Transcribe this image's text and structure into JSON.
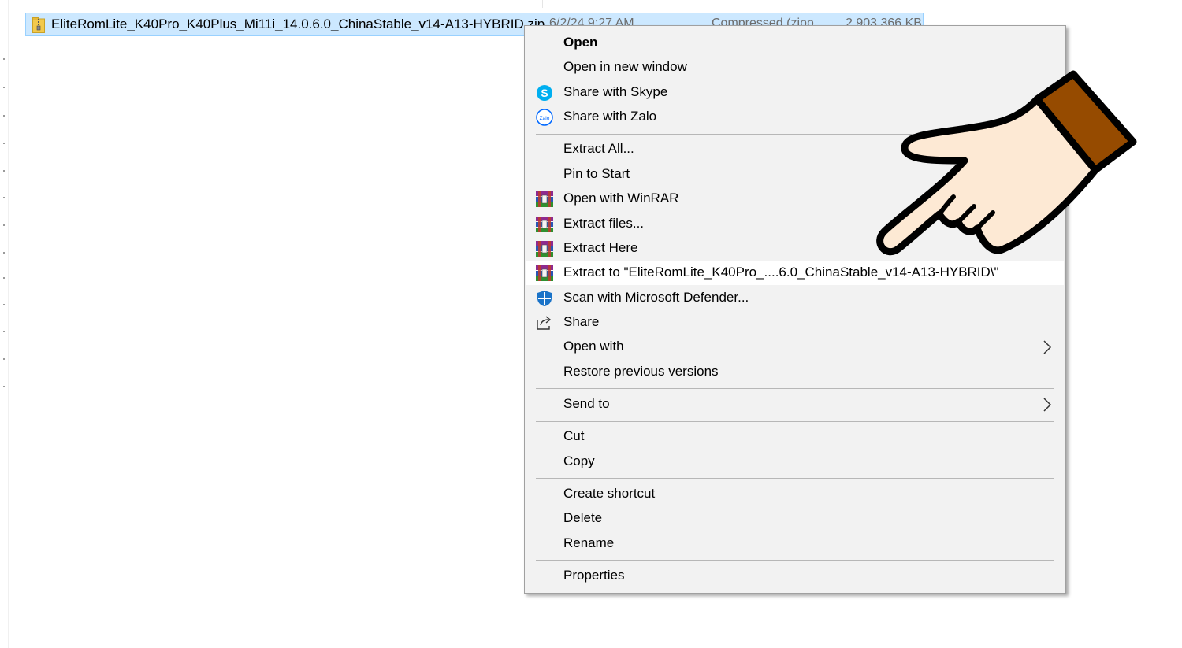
{
  "file": {
    "name": "EliteRomLite_K40Pro_K40Plus_Mi11i_14.0.6.0_ChinaStable_v14-A13-HYBRID.zip",
    "date": "6/2/24 9:27 AM",
    "type": "Compressed (zipp...",
    "size": "2,903,366 KB",
    "icon": "zip-folder-icon"
  },
  "menu": {
    "items": [
      {
        "label": "Open",
        "icon": ""
      },
      {
        "label": "Open in new window",
        "icon": ""
      },
      {
        "label": "Share with Skype",
        "icon": "skype-icon"
      },
      {
        "label": "Share with Zalo",
        "icon": "zalo-icon"
      },
      {
        "label": "Extract All...",
        "icon": ""
      },
      {
        "label": "Pin to Start",
        "icon": ""
      },
      {
        "label": "Open with WinRAR",
        "icon": "winrar-icon"
      },
      {
        "label": "Extract files...",
        "icon": "winrar-icon"
      },
      {
        "label": "Extract Here",
        "icon": "winrar-icon"
      },
      {
        "label": "Extract to \"EliteRomLite_K40Pro_....6.0_ChinaStable_v14-A13-HYBRID\\\"",
        "icon": "winrar-icon"
      },
      {
        "label": "Scan with Microsoft Defender...",
        "icon": "defender-icon"
      },
      {
        "label": "Share",
        "icon": "share-icon"
      },
      {
        "label": "Open with",
        "icon": ""
      },
      {
        "label": "Restore previous versions",
        "icon": ""
      },
      {
        "label": "Send to",
        "icon": ""
      },
      {
        "label": "Cut",
        "icon": ""
      },
      {
        "label": "Copy",
        "icon": ""
      },
      {
        "label": "Create shortcut",
        "icon": ""
      },
      {
        "label": "Delete",
        "icon": ""
      },
      {
        "label": "Rename",
        "icon": ""
      },
      {
        "label": "Properties",
        "icon": ""
      }
    ],
    "highlighted_item": "Extract to \"EliteRomLite_K40Pro_....6.0_ChinaStable_v14-A13-HYBRID\\\""
  },
  "colors": {
    "selection_bg": "#cce8ff",
    "menu_bg": "#f2f2f2",
    "hand_skin": "#fde9d4",
    "hand_cuff": "#964b00"
  }
}
